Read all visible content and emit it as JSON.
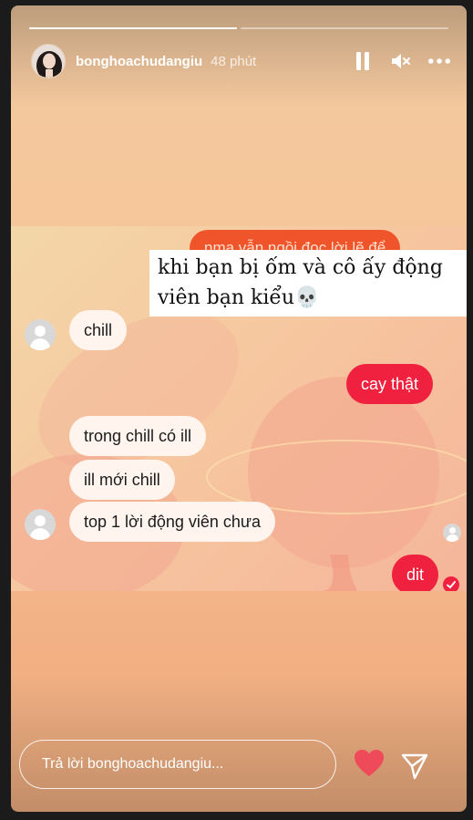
{
  "story": {
    "username": "bonghoachudangiu",
    "time_ago": "48 phút",
    "progress": [
      1.0,
      0.0
    ],
    "controls": {
      "pause_icon": "pause-icon",
      "mute_icon": "mute-icon",
      "more_icon": "more-icon"
    }
  },
  "screenshot": {
    "top_orange_bubble": "nma vẫn ngồi đọc lời lẽ để",
    "caption_line1": "khi bạn bị ốm và cô ấy động",
    "caption_line2": "viên bạn kiểu💀",
    "messages": [
      {
        "side": "left",
        "text": "chill"
      },
      {
        "side": "right",
        "text": "cay thật"
      },
      {
        "side": "left",
        "text": "trong chill có ill"
      },
      {
        "side": "left",
        "text": "ill mới chill"
      },
      {
        "side": "left",
        "text": "top 1 lời động viên chưa"
      },
      {
        "side": "right",
        "text": "dit"
      }
    ]
  },
  "reply": {
    "placeholder": "Trả lời bonghoachudangiu..."
  },
  "colors": {
    "accent_red": "#f0213f",
    "heart": "#ef4a5a"
  }
}
